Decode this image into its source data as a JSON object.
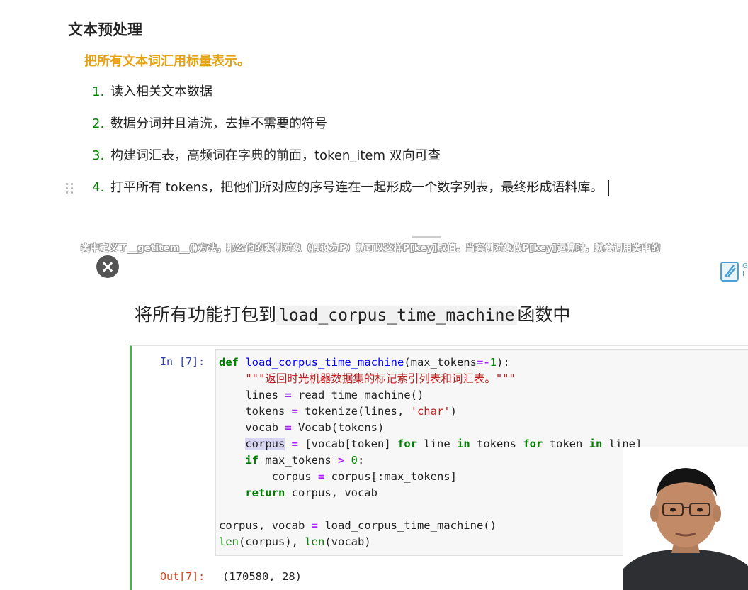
{
  "document": {
    "heading": "文本预处理",
    "subheading": "把所有文本词汇用标量表示。",
    "list": [
      {
        "num": "1.",
        "text": "读入相关文本数据"
      },
      {
        "num": "2.",
        "text": "数据分词并且清洗，去掉不需要的符号"
      },
      {
        "num": "3.",
        "text": "构建词汇表，高频词在字典的前面，token_item 双向可查"
      },
      {
        "num": "4.",
        "text": "打平所有 tokens，把他们所对应的序号连在一起形成一个数字列表，最终形成语料库。"
      }
    ]
  },
  "video": {
    "subtitle": "类中定义了__getitem__()方法，那么他的实例对象（假设为P）就可以这样P[key]取值。当实例对象做P[key]运算时，就会调用类中的",
    "close_icon": "close-icon",
    "logo_icon": "app-logo-icon",
    "logo_letters": "G\nI",
    "slide_title_prefix": "将所有功能打包到",
    "slide_title_code": "load_corpus_time_machine",
    "slide_title_suffix": "函数中",
    "prompt_in": "In [7]:",
    "prompt_out": "Out[7]:",
    "output": "(170580, 28)",
    "code_lines": [
      "def load_corpus_time_machine(max_tokens=-1):",
      "    \"\"\"返回时光机器数据集的标记索引列表和词汇表。\"\"\"",
      "    lines = read_time_machine()",
      "    tokens = tokenize(lines, 'char')",
      "    vocab = Vocab(tokens)",
      "    corpus = [vocab[token] for line in tokens for token in line]",
      "    if max_tokens > 0:",
      "        corpus = corpus[:max_tokens]",
      "    return corpus, vocab",
      "",
      "corpus, vocab = load_corpus_time_machine()",
      "len(corpus), len(vocab)"
    ]
  }
}
